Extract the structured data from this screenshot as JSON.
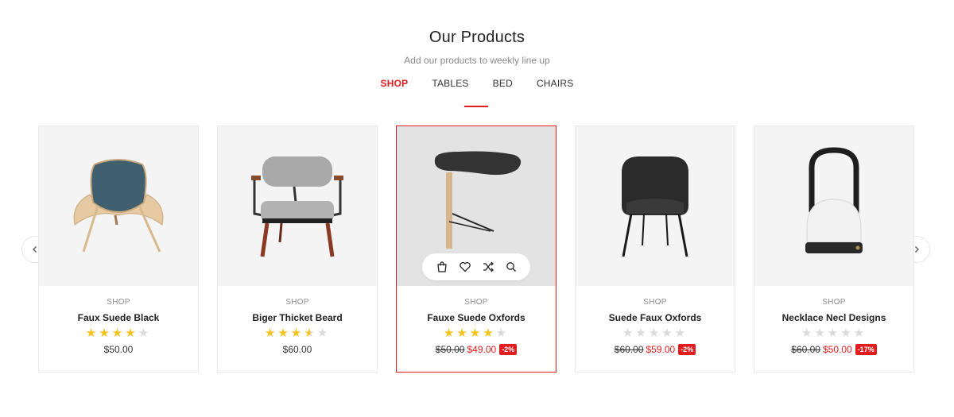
{
  "section": {
    "title": "Our Products",
    "subtitle": "Add our products to weekly line up"
  },
  "tabs": [
    {
      "label": "SHOP",
      "active": true
    },
    {
      "label": "TABLES",
      "active": false
    },
    {
      "label": "BED",
      "active": false
    },
    {
      "label": "CHAIRS",
      "active": false
    }
  ],
  "colors": {
    "accent": "#e21d1d",
    "star": "#f6c21c",
    "star_empty": "#dadada"
  },
  "products": [
    {
      "category": "SHOP",
      "name": "Faux Suede Black",
      "rating": 4,
      "price": "$50.00",
      "old_price": "",
      "new_price": "",
      "discount": "",
      "image": "lounge-chair-icon"
    },
    {
      "category": "SHOP",
      "name": "Biger Thicket Beard",
      "rating": 3.5,
      "price": "$60.00",
      "old_price": "",
      "new_price": "",
      "discount": "",
      "image": "armchair-icon"
    },
    {
      "category": "SHOP",
      "name": "Fauxe Suede Oxfords",
      "rating": 4,
      "price": "",
      "old_price": "$50.00",
      "new_price": "$49.00",
      "discount": "-2%",
      "image": "side-table-icon"
    },
    {
      "category": "SHOP",
      "name": "Suede Faux Oxfords",
      "rating": 0,
      "price": "",
      "old_price": "$60.00",
      "new_price": "$59.00",
      "discount": "-2%",
      "image": "tub-chair-icon"
    },
    {
      "category": "SHOP",
      "name": "Necklace Necl Designs",
      "rating": 0,
      "price": "",
      "old_price": "$60.00",
      "new_price": "$50.00",
      "discount": "-17%",
      "image": "lantern-icon"
    }
  ],
  "hover_actions": [
    "add-to-cart-icon",
    "wishlist-heart-icon",
    "compare-shuffle-icon",
    "quick-view-search-icon"
  ],
  "carousel": {
    "prev_icon": "chevron-left-icon",
    "next_icon": "chevron-right-icon"
  }
}
